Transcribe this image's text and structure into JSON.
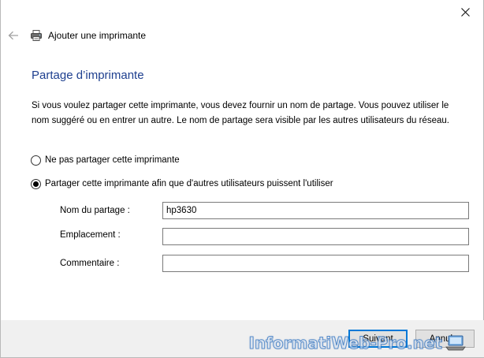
{
  "window": {
    "title": "Ajouter une imprimante"
  },
  "page": {
    "heading": "Partage d’imprimante",
    "description": "Si vous voulez partager cette imprimante, vous devez fournir un nom de partage. Vous pouvez utiliser le nom suggéré ou en entrer un autre. Le nom de partage sera visible par les autres utilisateurs du réseau."
  },
  "sharing": {
    "options": [
      {
        "label": "Ne pas partager cette imprimante",
        "selected": false
      },
      {
        "label": "Partager cette imprimante afin que d'autres utilisateurs puissent l'utiliser",
        "selected": true
      }
    ]
  },
  "fields": {
    "share_name": {
      "label": "Nom du partage :",
      "value": "hp3630"
    },
    "location": {
      "label": "Emplacement :",
      "value": ""
    },
    "comment": {
      "label": "Commentaire :",
      "value": ""
    }
  },
  "footer": {
    "next_label": "Suivant",
    "cancel_label": "Annuler"
  },
  "watermark": {
    "text": "InformatiWeb-Pro.net"
  },
  "icons": {
    "close": "close-icon",
    "back": "back-arrow-icon",
    "printer": "printer-icon",
    "watermark_logo": "laptop-logo-icon"
  },
  "colors": {
    "heading": "#1e3f8f",
    "primary_button_border": "#0078d7",
    "footer_bg": "#f0f0f0"
  }
}
